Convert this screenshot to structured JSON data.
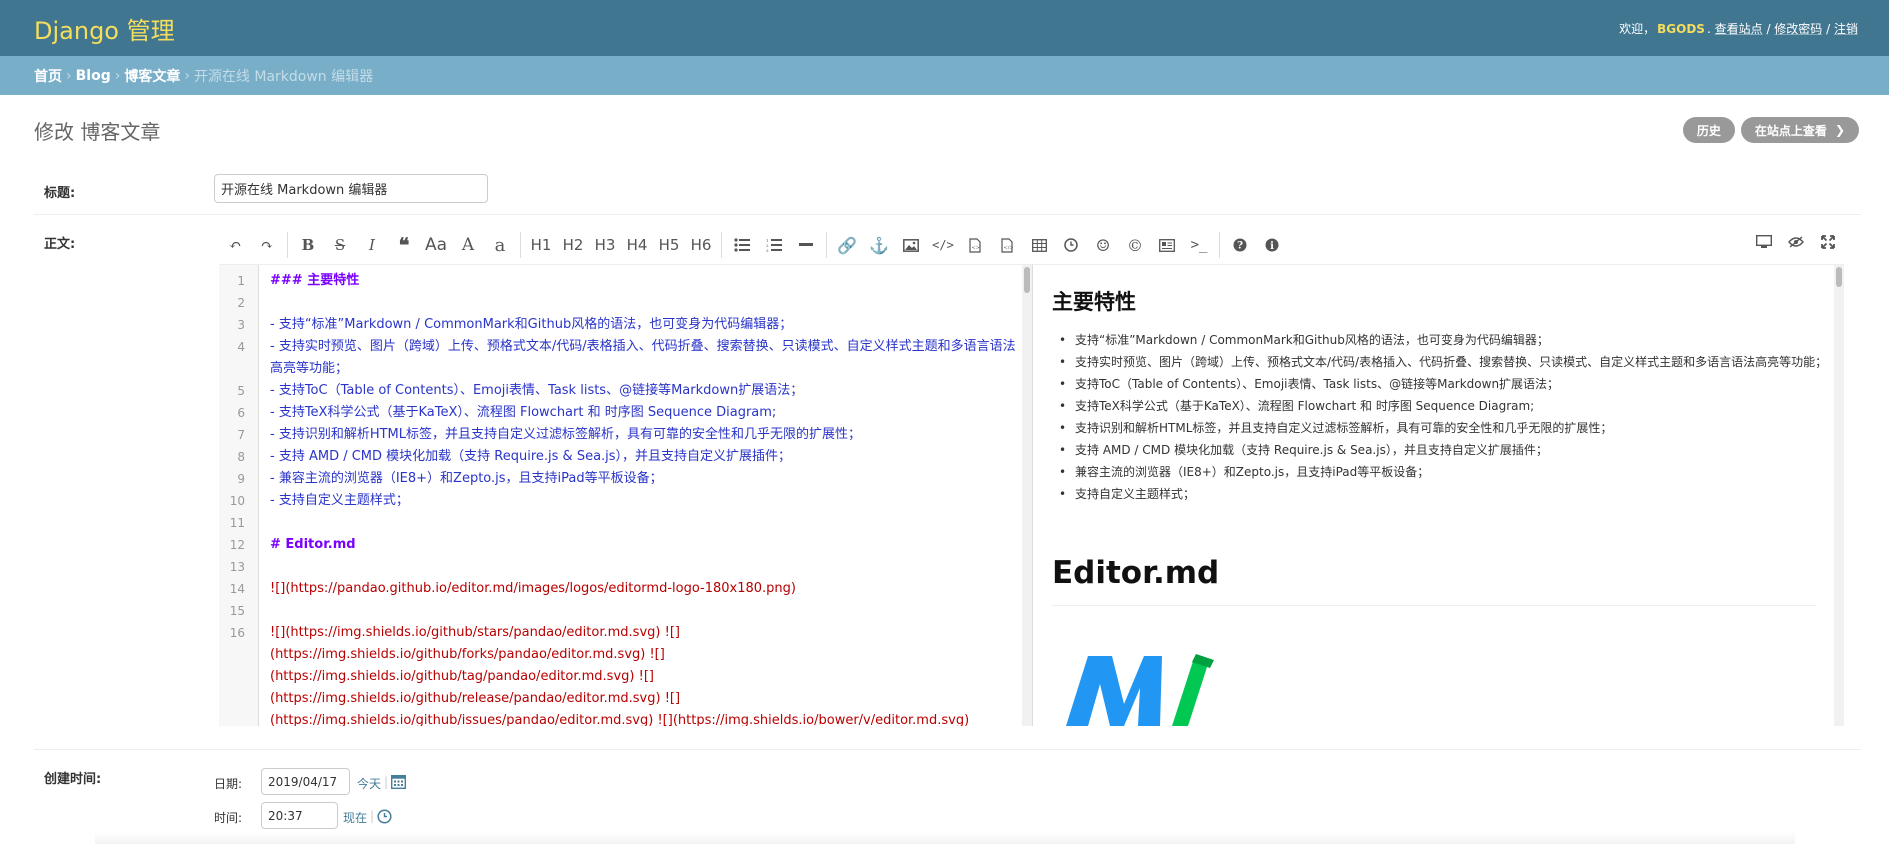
{
  "header": {
    "brand": "Django 管理",
    "welcome": "欢迎，",
    "username": "BGODS",
    "username_suffix": ".",
    "view_site": "查看站点",
    "change_password": "修改密码",
    "logout": "注销",
    "separator": " / "
  },
  "breadcrumbs": {
    "home": "首页",
    "app": "Blog",
    "model": "博客文章",
    "current": "开源在线 Markdown 编辑器",
    "sep": "›"
  },
  "page": {
    "title": "修改 博客文章",
    "history_button": "历史",
    "view_on_site_button": "在站点上查看"
  },
  "form": {
    "title_label": "标题:",
    "title_value": "开源在线 Markdown 编辑器",
    "body_label": "正文:",
    "created_label": "创建时间:",
    "date_label": "日期:",
    "date_value": "2019/04/17",
    "today_link": "今天",
    "time_label": "时间:",
    "time_value": "20:37",
    "now_link": "现在",
    "link_sep": "|"
  },
  "toolbar": {
    "headings": [
      "H1",
      "H2",
      "H3",
      "H4",
      "H5",
      "H6"
    ]
  },
  "code_lines": [
    {
      "n": "1",
      "t": "### 主要特性",
      "k": "head"
    },
    {
      "n": "2",
      "t": "",
      "k": "plain"
    },
    {
      "n": "3",
      "t": "- 支持“标准”Markdown / CommonMark和Github风格的语法，也可变身为代码编辑器；",
      "k": "list"
    },
    {
      "n": "4",
      "t": "- 支持实时预览、图片（跨域）上传、预格式文本/代码/表格插入、代码折叠、搜索替换、只读模式、自定义样式主题和多语言语法高亮等功能；",
      "k": "list"
    },
    {
      "n": "5",
      "t": "- 支持ToC（Table of Contents）、Emoji表情、Task lists、@链接等Markdown扩展语法；",
      "k": "list"
    },
    {
      "n": "6",
      "t": "- 支持TeX科学公式（基于KaTeX）、流程图 Flowchart 和 时序图 Sequence Diagram;",
      "k": "list"
    },
    {
      "n": "7",
      "t": "- 支持识别和解析HTML标签，并且支持自定义过滤标签解析，具有可靠的安全性和几乎无限的扩展性；",
      "k": "list"
    },
    {
      "n": "8",
      "t": "- 支持 AMD / CMD 模块化加载（支持 Require.js & Sea.js），并且支持自定义扩展插件；",
      "k": "list"
    },
    {
      "n": "9",
      "t": "- 兼容主流的浏览器（IE8+）和Zepto.js，且支持iPad等平板设备；",
      "k": "list"
    },
    {
      "n": "10",
      "t": "- 支持自定义主题样式；",
      "k": "list"
    },
    {
      "n": "11",
      "t": "",
      "k": "plain"
    },
    {
      "n": "12",
      "t": "# Editor.md",
      "k": "head"
    },
    {
      "n": "13",
      "t": "",
      "k": "plain"
    },
    {
      "n": "14",
      "t": "![](https://pandao.github.io/editor.md/images/logos/editormd-logo-180x180.png)",
      "k": "link"
    },
    {
      "n": "15",
      "t": "",
      "k": "plain"
    },
    {
      "n": "16",
      "t": "![](https://img.shields.io/github/stars/pandao/editor.md.svg) ![](https://img.shields.io/github/forks/pandao/editor.md.svg) ![](https://img.shields.io/github/tag/pandao/editor.md.svg) ![](https://img.shields.io/github/release/pandao/editor.md.svg) ![](https://img.shields.io/github/issues/pandao/editor.md.svg) ![](https://img.shields.io/bower/v/editor.md.svg)",
      "k": "link"
    }
  ],
  "preview": {
    "h3": "主要特性",
    "items": [
      "支持“标准”Markdown / CommonMark和Github风格的语法，也可变身为代码编辑器；",
      "支持实时预览、图片（跨域）上传、预格式文本/代码/表格插入、代码折叠、搜索替换、只读模式、自定义样式主题和多语言语法高亮等功能；",
      "支持ToC（Table of Contents）、Emoji表情、Task lists、@链接等Markdown扩展语法；",
      "支持TeX科学公式（基于KaTeX）、流程图 Flowchart 和 时序图 Sequence Diagram;",
      "支持识别和解析HTML标签，并且支持自定义过滤标签解析，具有可靠的安全性和几乎无限的扩展性；",
      "支持 AMD / CMD 模块化加载（支持 Require.js & Sea.js），并且支持自定义扩展插件；",
      "兼容主流的浏览器（IE8+）和Zepto.js，且支持iPad等平板设备；",
      "支持自定义主题样式；"
    ],
    "h1": "Editor.md"
  },
  "colors": {
    "header_bg": "#417690",
    "brand": "#f5dd5d",
    "breadcrumb_bg": "#79aec8",
    "link": "#447e9b",
    "button_gray": "#999999",
    "logo_blue": "#2196f3",
    "logo_green": "#00c853"
  }
}
